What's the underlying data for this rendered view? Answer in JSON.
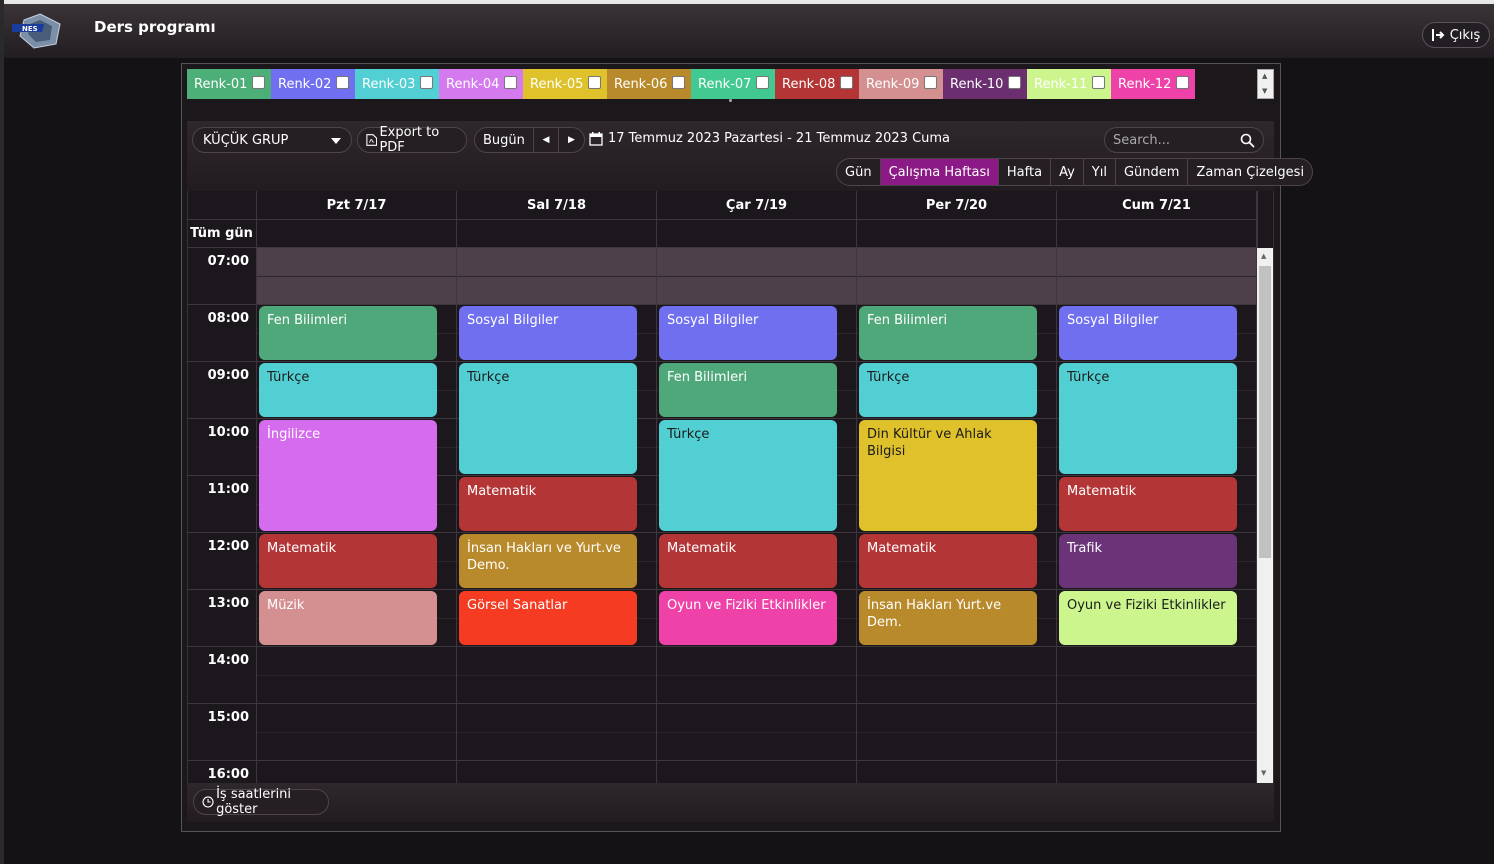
{
  "app": {
    "title": "Ders programı",
    "exit_label": "Çıkış"
  },
  "legend": [
    {
      "label": "Renk-01",
      "color": "#4caf78"
    },
    {
      "label": "Renk-02",
      "color": "#6f6ff0"
    },
    {
      "label": "Renk-03",
      "color": "#52cfd3"
    },
    {
      "label": "Renk-04",
      "color": "#d47aee"
    },
    {
      "label": "Renk-05",
      "color": "#dfc22b"
    },
    {
      "label": "Renk-06",
      "color": "#b98a2b"
    },
    {
      "label": "Renk-07",
      "color": "#42c991"
    },
    {
      "label": "Renk-08",
      "color": "#b33535"
    },
    {
      "label": "Renk-09",
      "color": "#d49090"
    },
    {
      "label": "Renk-10",
      "color": "#6b2f6f"
    },
    {
      "label": "Renk-11",
      "color": "#cdf58e"
    },
    {
      "label": "Renk-12",
      "color": "#ef42a8"
    }
  ],
  "toolbar": {
    "group": "KÜÇÜK GRUP",
    "export": "Export to PDF",
    "today": "Bugün",
    "date_range": "17 Temmuz 2023 Pazartesi - 21 Temmuz 2023 Cuma",
    "search_placeholder": "Search..."
  },
  "views": [
    "Gün",
    "Çalışma Haftası",
    "Hafta",
    "Ay",
    "Yıl",
    "Gündem",
    "Zaman Çizelgesi"
  ],
  "active_view": "Çalışma Haftası",
  "days": [
    "Pzt 7/17",
    "Sal 7/18",
    "Çar 7/19",
    "Per 7/20",
    "Cum 7/21"
  ],
  "allday_label": "Tüm gün",
  "hours": [
    "07:00",
    "08:00",
    "09:00",
    "10:00",
    "11:00",
    "12:00",
    "13:00",
    "14:00",
    "15:00",
    "16:00"
  ],
  "events": [
    {
      "day": 0,
      "start": 8,
      "end": 9,
      "title": "Fen Bilimleri",
      "color": "#4fa879"
    },
    {
      "day": 0,
      "start": 9,
      "end": 10,
      "title": "Türkçe",
      "color": "#52cfd3",
      "dark": true
    },
    {
      "day": 0,
      "start": 10,
      "end": 12,
      "title": "İngilizce",
      "color": "#d46ced"
    },
    {
      "day": 0,
      "start": 12,
      "end": 13,
      "title": "Matematik",
      "color": "#b33535"
    },
    {
      "day": 0,
      "start": 13,
      "end": 14,
      "title": "Müzik",
      "color": "#d49090"
    },
    {
      "day": 1,
      "start": 8,
      "end": 9,
      "title": "Sosyal Bilgiler",
      "color": "#6f6ff0"
    },
    {
      "day": 1,
      "start": 9,
      "end": 11,
      "title": "Türkçe",
      "color": "#52cfd3",
      "dark": true
    },
    {
      "day": 1,
      "start": 11,
      "end": 12,
      "title": "Matematik",
      "color": "#b33535"
    },
    {
      "day": 1,
      "start": 12,
      "end": 13,
      "title": "İnsan Hakları ve Yurt.ve Demo.",
      "color": "#b98a2b"
    },
    {
      "day": 1,
      "start": 13,
      "end": 14,
      "title": "Görsel Sanatlar",
      "color": "#f53b22"
    },
    {
      "day": 2,
      "start": 8,
      "end": 9,
      "title": "Sosyal Bilgiler",
      "color": "#6f6ff0"
    },
    {
      "day": 2,
      "start": 9,
      "end": 10,
      "title": "Fen Bilimleri",
      "color": "#4fa879"
    },
    {
      "day": 2,
      "start": 10,
      "end": 12,
      "title": "Türkçe",
      "color": "#52cfd3",
      "dark": true
    },
    {
      "day": 2,
      "start": 12,
      "end": 13,
      "title": "Matematik",
      "color": "#b33535"
    },
    {
      "day": 2,
      "start": 13,
      "end": 14,
      "title": "Oyun ve Fiziki Etkinlikler",
      "color": "#ef42a8"
    },
    {
      "day": 3,
      "start": 8,
      "end": 9,
      "title": "Fen Bilimleri",
      "color": "#4fa879"
    },
    {
      "day": 3,
      "start": 9,
      "end": 10,
      "title": "Türkçe",
      "color": "#52cfd3",
      "dark": true
    },
    {
      "day": 3,
      "start": 10,
      "end": 12,
      "title": "Din Kültür ve Ahlak Bilgisi",
      "color": "#dfc22b",
      "dark": true
    },
    {
      "day": 3,
      "start": 12,
      "end": 13,
      "title": "Matematik",
      "color": "#b33535"
    },
    {
      "day": 3,
      "start": 13,
      "end": 14,
      "title": "İnsan Hakları Yurt.ve Dem.",
      "color": "#b98a2b"
    },
    {
      "day": 4,
      "start": 8,
      "end": 9,
      "title": "Sosyal Bilgiler",
      "color": "#6f6ff0"
    },
    {
      "day": 4,
      "start": 9,
      "end": 11,
      "title": "Türkçe",
      "color": "#52cfd3",
      "dark": true
    },
    {
      "day": 4,
      "start": 11,
      "end": 12,
      "title": "Matematik",
      "color": "#b33535"
    },
    {
      "day": 4,
      "start": 12,
      "end": 13,
      "title": "Trafik",
      "color": "#6b3478"
    },
    {
      "day": 4,
      "start": 13,
      "end": 14,
      "title": "Oyun ve Fiziki Etkinlikler",
      "color": "#cdf58e",
      "dark": true
    }
  ],
  "footer": {
    "work_hours": "İş saatlerini göster"
  }
}
